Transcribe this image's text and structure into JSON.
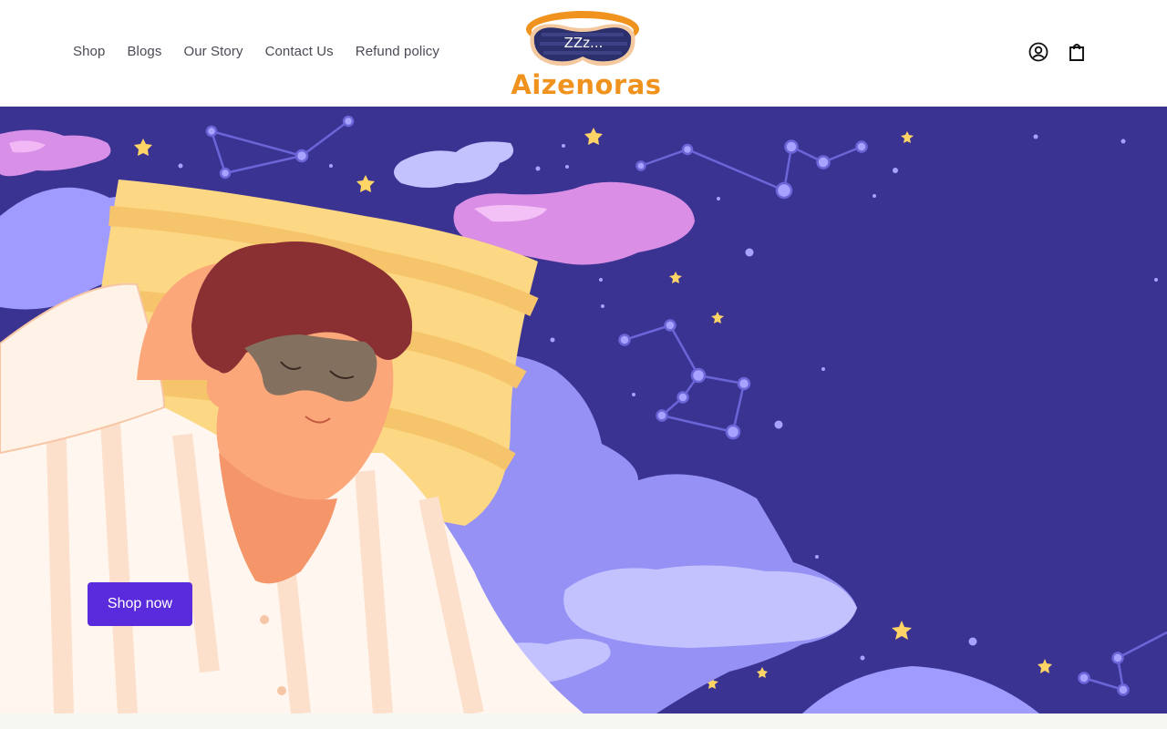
{
  "header": {
    "nav": [
      {
        "label": "Shop"
      },
      {
        "label": "Blogs"
      },
      {
        "label": "Our Story"
      },
      {
        "label": "Contact Us"
      },
      {
        "label": "Refund policy"
      }
    ],
    "logo": {
      "text": "Aizenoras",
      "mask_text": "ZZz..."
    },
    "icons": [
      "account-icon",
      "cart-icon"
    ]
  },
  "hero": {
    "cta_label": "Shop now",
    "background_color": "#3b3391",
    "accent_color": "#5a2bdc"
  }
}
